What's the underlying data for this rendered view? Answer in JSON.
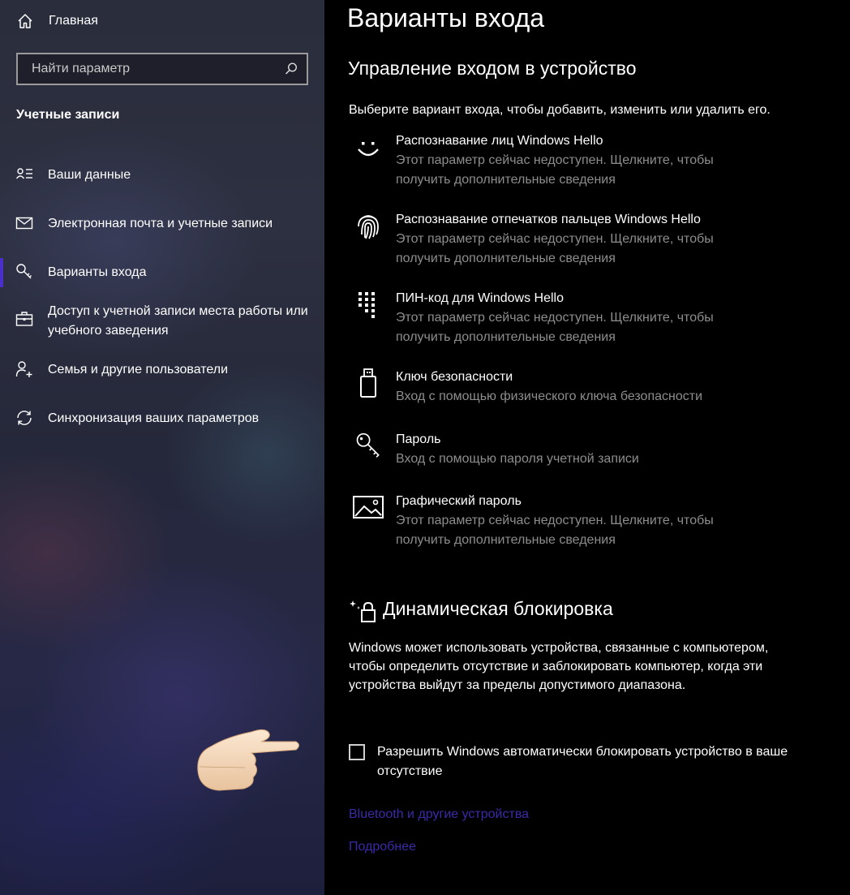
{
  "sidebar": {
    "home_label": "Главная",
    "search_placeholder": "Найти параметр",
    "section_title": "Учетные записи",
    "items": [
      {
        "label": "Ваши данные",
        "icon": "user-info-icon"
      },
      {
        "label": "Электронная почта и учетные записи",
        "icon": "mail-icon"
      },
      {
        "label": "Варианты входа",
        "icon": "key-icon",
        "active": true
      },
      {
        "label": "Доступ к учетной записи места работы или учебного заведения",
        "icon": "briefcase-icon"
      },
      {
        "label": "Семья и другие пользователи",
        "icon": "add-user-icon"
      },
      {
        "label": "Синхронизация ваших параметров",
        "icon": "sync-icon"
      }
    ],
    "accent_color": "#4b2fc9"
  },
  "main": {
    "title": "Варианты входа",
    "subtitle": "Управление входом в устройство",
    "description": "Выберите вариант входа, чтобы добавить, изменить или удалить его.",
    "options": [
      {
        "name": "Распознавание лиц Windows Hello",
        "detail": "Этот параметр сейчас недоступен. Щелкните, чтобы получить дополнительные сведения",
        "icon": "face-icon"
      },
      {
        "name": "Распознавание отпечатков пальцев Windows Hello",
        "detail": "Этот параметр сейчас недоступен. Щелкните, чтобы получить дополнительные сведения",
        "icon": "fingerprint-icon"
      },
      {
        "name": "ПИН-код для Windows Hello",
        "detail": "Этот параметр сейчас недоступен. Щелкните, чтобы получить дополнительные сведения",
        "icon": "pin-keypad-icon"
      },
      {
        "name": "Ключ безопасности",
        "detail": "Вход с помощью физического ключа безопасности",
        "icon": "usb-key-icon"
      },
      {
        "name": "Пароль",
        "detail": "Вход с помощью пароля учетной записи",
        "icon": "password-key-icon"
      },
      {
        "name": "Графический пароль",
        "detail": "Этот параметр сейчас недоступен. Щелкните, чтобы получить дополнительные сведения",
        "icon": "picture-password-icon"
      }
    ],
    "dynamic_lock": {
      "title": "Динамическая блокировка",
      "description": "Windows может использовать устройства, связанные с компьютером, чтобы определить отсутствие и заблокировать компьютер, когда эти устройства выйдут за пределы допустимого диапазона.",
      "checkbox_label": "Разрешить Windows автоматически блокировать устройство в ваше отсутствие",
      "checkbox_checked": false
    },
    "links": {
      "bluetooth": "Bluetooth и другие устройства",
      "more": "Подробнее"
    },
    "link_color": "#3b2aa8"
  }
}
